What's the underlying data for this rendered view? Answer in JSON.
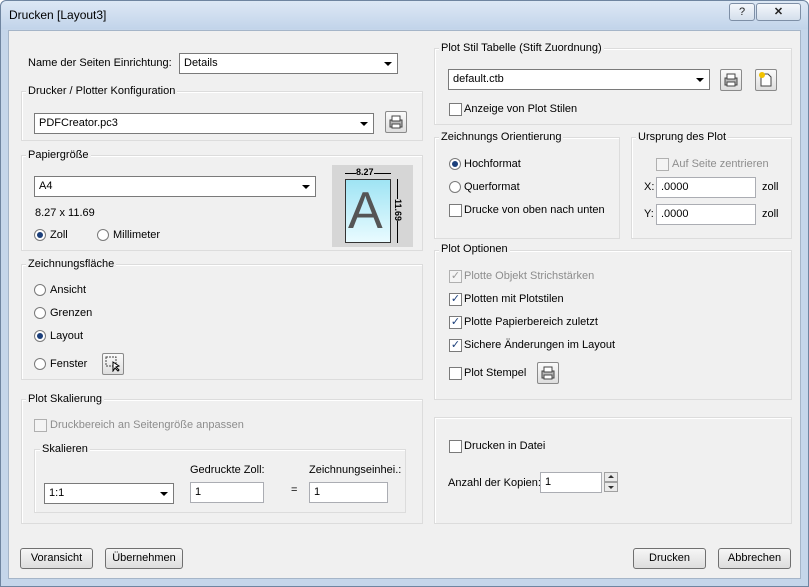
{
  "window": {
    "title": "Drucken [Layout3]",
    "help_label": "?",
    "close_label": "✕"
  },
  "page_setup": {
    "label": "Name der Seiten Einrichtung:",
    "value": "Details"
  },
  "printer": {
    "group_title": "Drucker / Plotter Konfiguration",
    "value": "PDFCreator.pc3",
    "properties_icon": "printer-properties-icon"
  },
  "paper": {
    "group_title": "Papiergröße",
    "value": "A4",
    "size_text": "8.27 x 11.69",
    "unit_inch": "Zoll",
    "unit_mm": "Millimeter",
    "selected_unit": "Zoll",
    "preview": {
      "width_label": "8.27",
      "height_label": "11.69",
      "letter": "A"
    }
  },
  "plot_area": {
    "group_title": "Zeichnungsfläche",
    "options": [
      "Ansicht",
      "Grenzen",
      "Layout",
      "Fenster"
    ],
    "selected": "Layout",
    "window_pick_icon": "pick-window-icon"
  },
  "scale": {
    "group_title": "Plot Skalierung",
    "fit_label": "Druckbereich an Seitengröße anpassen",
    "sub_title": "Skalieren",
    "scale_value": "1:1",
    "printed_label": "Gedruckte Zoll:",
    "printed_value": "1",
    "equals": "=",
    "drawing_label": "Zeichnungseinhei.:",
    "drawing_value": "1"
  },
  "plot_style": {
    "group_title": "Plot Stil Tabelle (Stift Zuordnung)",
    "value": "default.ctb",
    "show_label": "Anzeige von Plot Stilen",
    "edit_icon": "edit-table-icon",
    "new_icon": "new-file-icon"
  },
  "orientation": {
    "group_title": "Zeichnungs Orientierung",
    "portrait": "Hochformat",
    "landscape": "Querformat",
    "selected": "Hochformat",
    "upside_down": "Drucke von oben nach unten"
  },
  "origin": {
    "group_title": "Ursprung des Plot",
    "center_label": "Auf Seite zentrieren",
    "x_label": "X:",
    "x_value": ".0000",
    "x_unit": "zoll",
    "y_label": "Y:",
    "y_value": ".0000",
    "y_unit": "zoll"
  },
  "plot_options": {
    "group_title": "Plot Optionen",
    "lineweights": "Plotte Objekt Strichstärken",
    "with_styles": "Plotten mit Plotstilen",
    "paperspace_last": "Plotte Papierbereich zuletzt",
    "save_changes": "Sichere Änderungen im Layout",
    "stamp": "Plot Stempel",
    "stamp_icon": "stamp-settings-icon"
  },
  "output": {
    "to_file": "Drucken in Datei",
    "copies_label": "Anzahl der Kopien:",
    "copies_value": "1"
  },
  "buttons": {
    "preview": "Voransicht",
    "apply": "Übernehmen",
    "print": "Drucken",
    "cancel": "Abbrechen"
  }
}
